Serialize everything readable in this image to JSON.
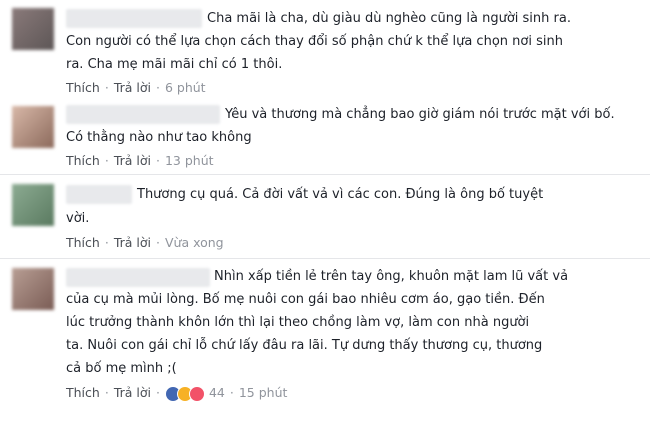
{
  "comments": [
    {
      "lines": [
        "Cha mãi là cha, dù giàu dù nghèo cũng là người sinh ra.",
        "Con người có thể lựa chọn cách thay đổi số phận chứ k thể lựa chọn nơi sinh",
        "ra. Cha mẹ mãi mãi chỉ có 1 thôi."
      ],
      "like": "Thích",
      "reply": "Trả lời",
      "time": "6 phút",
      "react_count": ""
    },
    {
      "lines": [
        "Yêu và thương mà chẳng bao giờ giám nói trước mặt với bố.",
        "Có thằng nào như tao không"
      ],
      "like": "Thích",
      "reply": "Trả lời",
      "time": "13 phút",
      "react_count": ""
    },
    {
      "lines": [
        "Thương cụ quá. Cả đời vất vả vì các con. Đúng là ông bố tuyệt",
        "vời."
      ],
      "like": "Thích",
      "reply": "Trả lời",
      "time": "Vừa xong",
      "react_count": ""
    },
    {
      "lines": [
        "Nhìn xấp tiền lẻ trên tay ông, khuôn mặt lam lũ vất vả",
        "của cụ mà mủi lòng. Bố mẹ nuôi con gái bao nhiêu cơm áo, gạo tiền. Đến",
        "lúc trưởng thành khôn lớn thì lại theo chồng làm vợ, làm con nhà người",
        "ta. Nuôi con gái chỉ lỗ chứ lấy đâu ra lãi. Tự dưng thấy thương cụ, thương",
        "cả bố mẹ mình ;("
      ],
      "like": "Thích",
      "reply": "Trả lời",
      "time": "15 phút",
      "react_count": "44",
      "reactions": [
        "like-icon",
        "sad-icon",
        "love-icon"
      ]
    }
  ],
  "colors": {
    "text": "#1d2129",
    "meta": "#90949c",
    "link": "#4b4f56"
  }
}
